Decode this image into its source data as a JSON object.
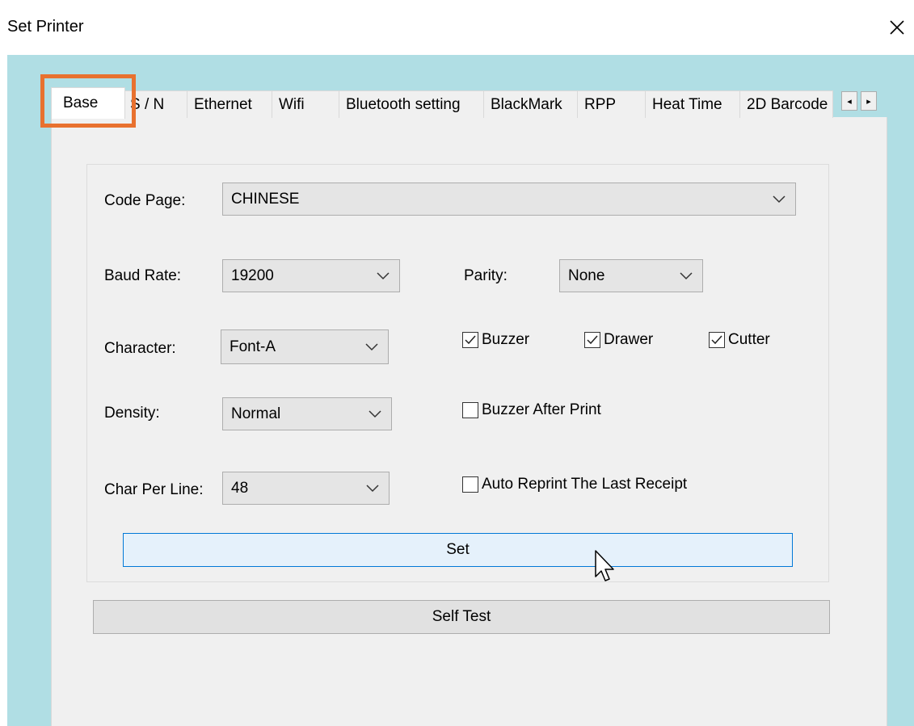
{
  "window": {
    "title": "Set Printer",
    "close_icon": "close-icon"
  },
  "tabs": [
    {
      "label": "Base",
      "active": true
    },
    {
      "label": "S / N"
    },
    {
      "label": "Ethernet"
    },
    {
      "label": "Wifi"
    },
    {
      "label": "Bluetooth setting"
    },
    {
      "label": "BlackMark"
    },
    {
      "label": "RPP"
    },
    {
      "label": "Heat Time"
    },
    {
      "label": "2D Barcode"
    }
  ],
  "tab_scroll": {
    "left": "◂",
    "right": "▸"
  },
  "form": {
    "code_page": {
      "label": "Code Page:",
      "value": "CHINESE"
    },
    "baud_rate": {
      "label": "Baud Rate:",
      "value": "19200"
    },
    "parity": {
      "label": "Parity:",
      "value": "None"
    },
    "character": {
      "label": "Character:",
      "value": "Font-A"
    },
    "density": {
      "label": "Density:",
      "value": "Normal"
    },
    "char_per_line": {
      "label": "Char Per Line:",
      "value": "48"
    },
    "buzzer": {
      "label": "Buzzer",
      "checked": true
    },
    "drawer": {
      "label": "Drawer",
      "checked": true
    },
    "cutter": {
      "label": "Cutter",
      "checked": true
    },
    "buzzer_after_print": {
      "label": "Buzzer After Print",
      "checked": false
    },
    "auto_reprint": {
      "label": "Auto Reprint The Last Receipt",
      "checked": false
    }
  },
  "buttons": {
    "set": "Set",
    "self_test": "Self Test"
  },
  "colors": {
    "client_bg": "#b0dee4",
    "highlight": "#e8712f",
    "set_button_border": "#0078d7"
  }
}
